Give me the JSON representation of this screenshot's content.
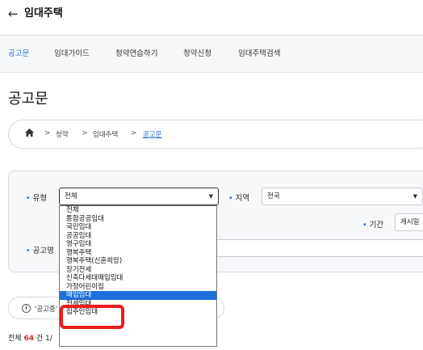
{
  "header": {
    "back_icon": "←",
    "title": "임대주택"
  },
  "tabs": [
    "공고문",
    "임대가이드",
    "청약연습하기",
    "청약신청",
    "임대주택검색"
  ],
  "active_tab": "공고문",
  "page_title": "공고문",
  "breadcrumb": {
    "home_icon": "home-icon",
    "sep": ">",
    "items": [
      "청약",
      "임대주택",
      "공고문"
    ]
  },
  "filters": {
    "type_label": "유형",
    "type_value": "전체",
    "region_label": "지역",
    "region_value": "전국",
    "period_label": "기간",
    "period_value": "게시일",
    "name_label": "공고명",
    "bullet": "•",
    "caret": "▼"
  },
  "notice": {
    "icon": "i",
    "text": "'공고중'"
  },
  "total": {
    "prefix": "전체",
    "count": "64",
    "unit": "건",
    "page": "1/",
    "suffix": ""
  },
  "dropdown_options": [
    "전체",
    "통합공공임대",
    "국민임대",
    "공공임대",
    "영구임대",
    "행복주택",
    "행복주택(신혼희망)",
    "장기전세",
    "신축다세대매입임대",
    "가정어린이집",
    "매입임대",
    "전세임대",
    "집주인임대"
  ],
  "selected_option": "매입임대",
  "colors": {
    "accent": "#2b6fd6",
    "highlight": "#ee1c1c",
    "selection": "#1e6fd9",
    "count": "#d22c2c"
  }
}
